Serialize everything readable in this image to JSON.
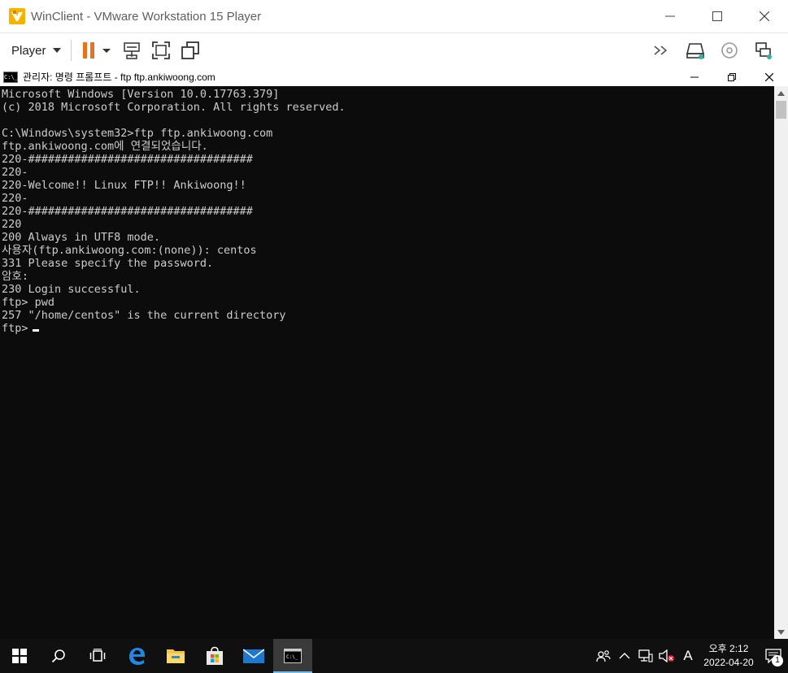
{
  "vm": {
    "title": "WinClient - VMware Workstation 15 Player",
    "player_menu_label": "Player"
  },
  "cmd": {
    "title": "관리자: 명령 프롬프트 - ftp  ftp.ankiwoong.com",
    "icon_text": "C:\\_"
  },
  "console": {
    "lines": [
      "Microsoft Windows [Version 10.0.17763.379]",
      "(c) 2018 Microsoft Corporation. All rights reserved.",
      "",
      "C:\\Windows\\system32>ftp ftp.ankiwoong.com",
      "ftp.ankiwoong.com에 연결되었습니다.",
      "220-##################################",
      "220-",
      "220-Welcome!! Linux FTP!! Ankiwoong!!",
      "220-",
      "220-##################################",
      "220",
      "200 Always in UTF8 mode.",
      "사용자(ftp.ankiwoong.com:(none)): centos",
      "331 Please specify the password.",
      "암호:",
      "230 Login successful.",
      "ftp> pwd",
      "257 \"/home/centos\" is the current directory"
    ],
    "prompt": "ftp>"
  },
  "taskbar": {
    "clock_time": "오후 2:12",
    "clock_date": "2022-04-20",
    "ime_label": "A",
    "notification_count": "1"
  }
}
